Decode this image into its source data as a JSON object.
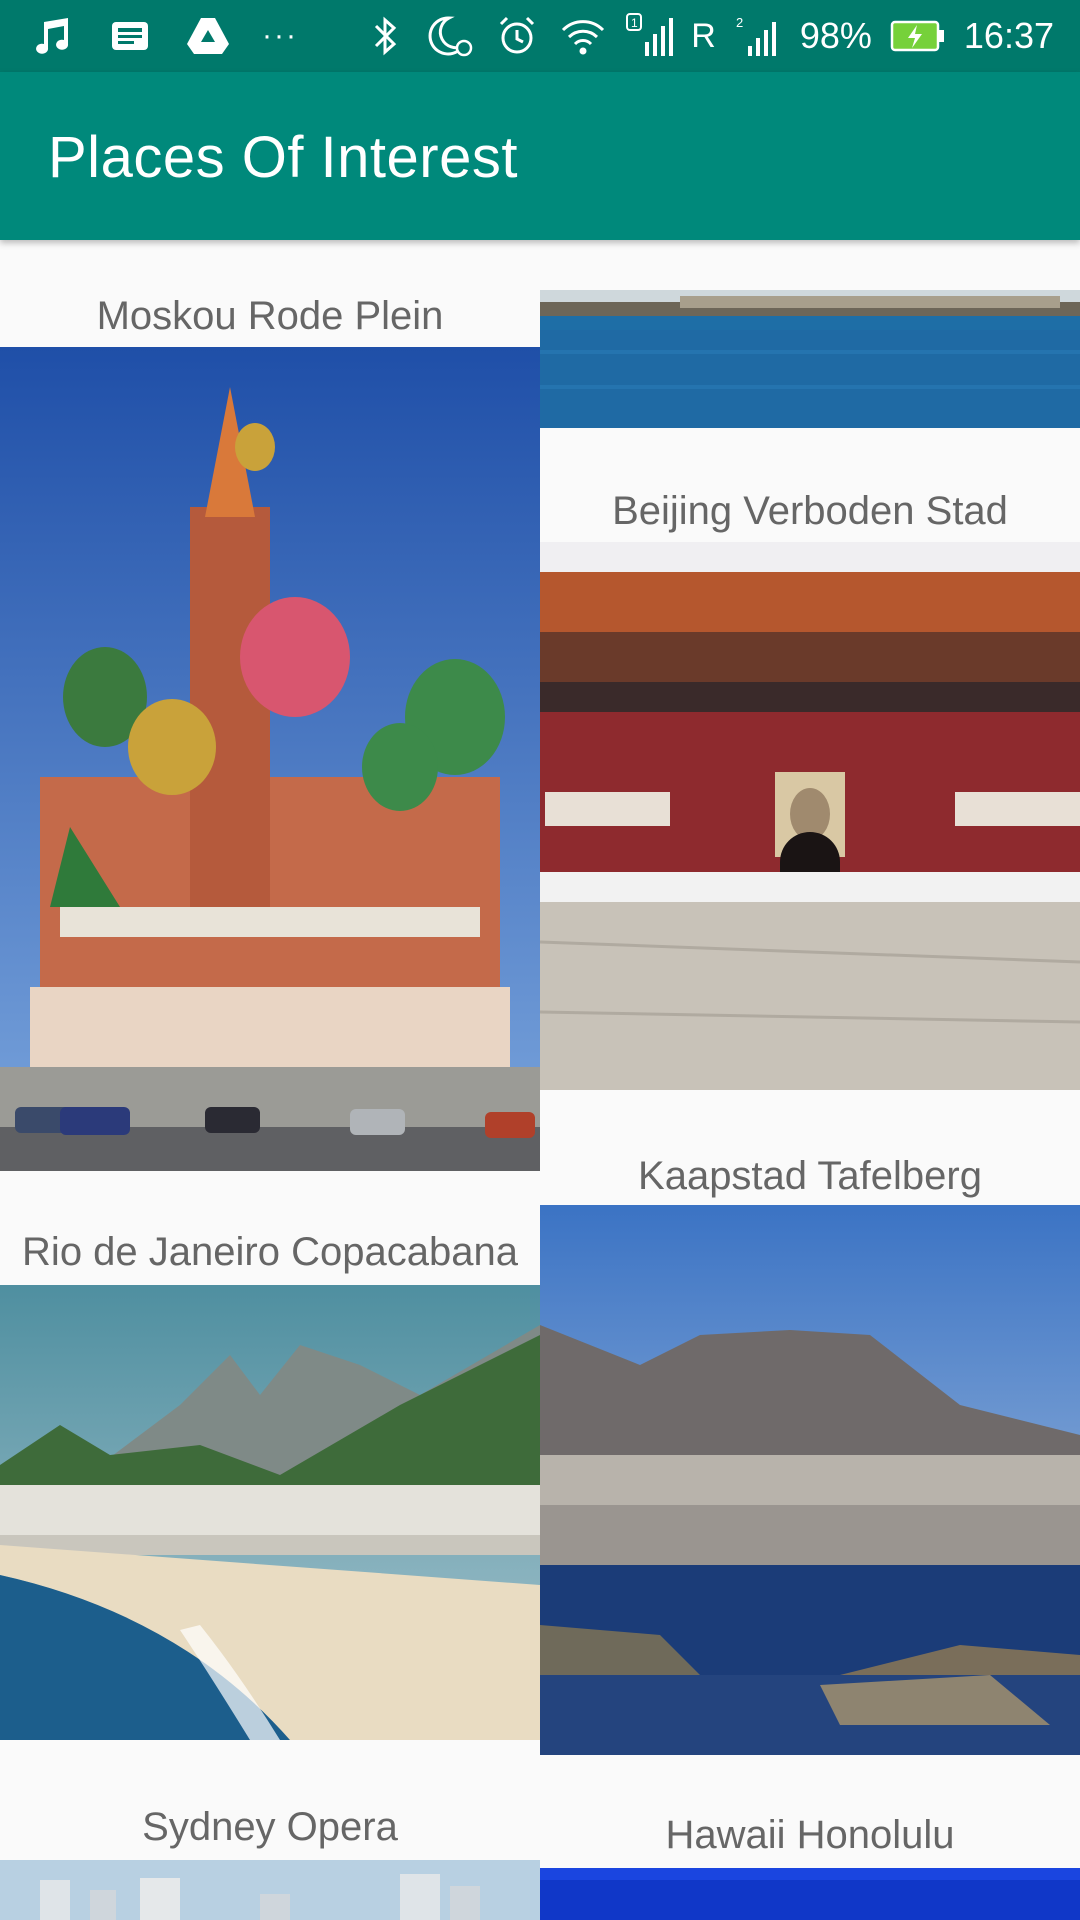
{
  "status_bar": {
    "icons": [
      "music-note-icon",
      "news-icon",
      "drive-icon",
      "more-dots-icon",
      "bluetooth-icon",
      "do-not-disturb-icon",
      "alarm-icon",
      "wifi-icon",
      "signal-sim1-icon",
      "signal-sim2-icon",
      "battery-charging-icon"
    ],
    "more_dots": "···",
    "roaming": "R",
    "battery": "98%",
    "time": "16:37"
  },
  "app_bar": {
    "title": "Places Of Interest",
    "color": "#00897b"
  },
  "places": [
    {
      "caption": "Moskou Rode Plein",
      "image": "st-basils-cathedral-photo"
    },
    {
      "caption": "",
      "image": "harbor-water-photo"
    },
    {
      "caption": "Beijing Verboden Stad",
      "image": "tiananmen-gate-photo"
    },
    {
      "caption": "Rio de Janeiro Copacabana",
      "image": "copacabana-beach-photo"
    },
    {
      "caption": "Kaapstad Tafelberg",
      "image": "table-mountain-photo"
    },
    {
      "caption": "Sydney Opera",
      "image": "sydney-city-photo"
    },
    {
      "caption": "Hawaii Honolulu",
      "image": "honolulu-photo"
    }
  ]
}
